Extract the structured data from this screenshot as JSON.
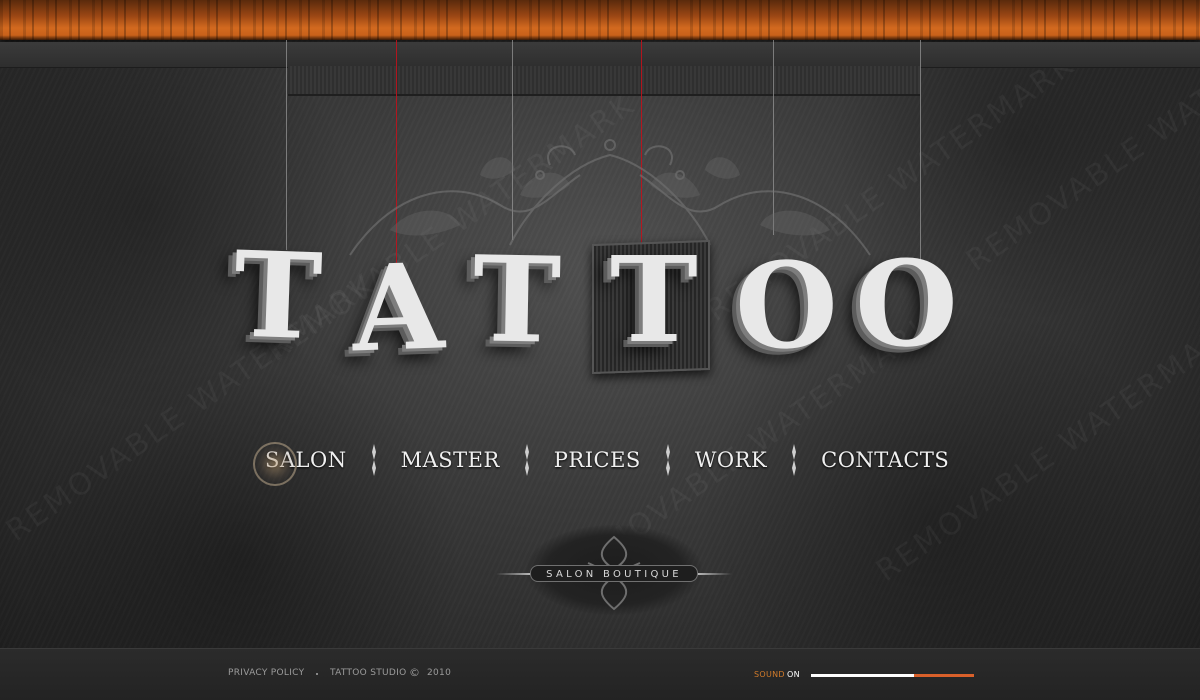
{
  "logo": {
    "letters": [
      "T",
      "A",
      "T",
      "T",
      "O",
      "O"
    ]
  },
  "nav": {
    "items": [
      {
        "label": "SALON",
        "active": true
      },
      {
        "label": "MASTER",
        "active": false
      },
      {
        "label": "PRICES",
        "active": false
      },
      {
        "label": "WORK",
        "active": false
      },
      {
        "label": "CONTACTS",
        "active": false
      }
    ]
  },
  "badge": {
    "text": "SALON BOUTIQUE"
  },
  "footer": {
    "privacy_label": "PRIVACY POLICY",
    "studio_label": "TATTOO STUDIO",
    "copyright_symbol": "©",
    "year": "2010",
    "sound_label": "SOUND",
    "sound_state": "ON",
    "sound_level": 0.63
  },
  "watermark": {
    "text": "REMOVABLE WATERMARK"
  },
  "colors": {
    "accent_orange": "#d36a1f",
    "string_red": "#c0121c",
    "nav_text": "#f0f0f0",
    "footer_text": "#9b9b9b"
  }
}
